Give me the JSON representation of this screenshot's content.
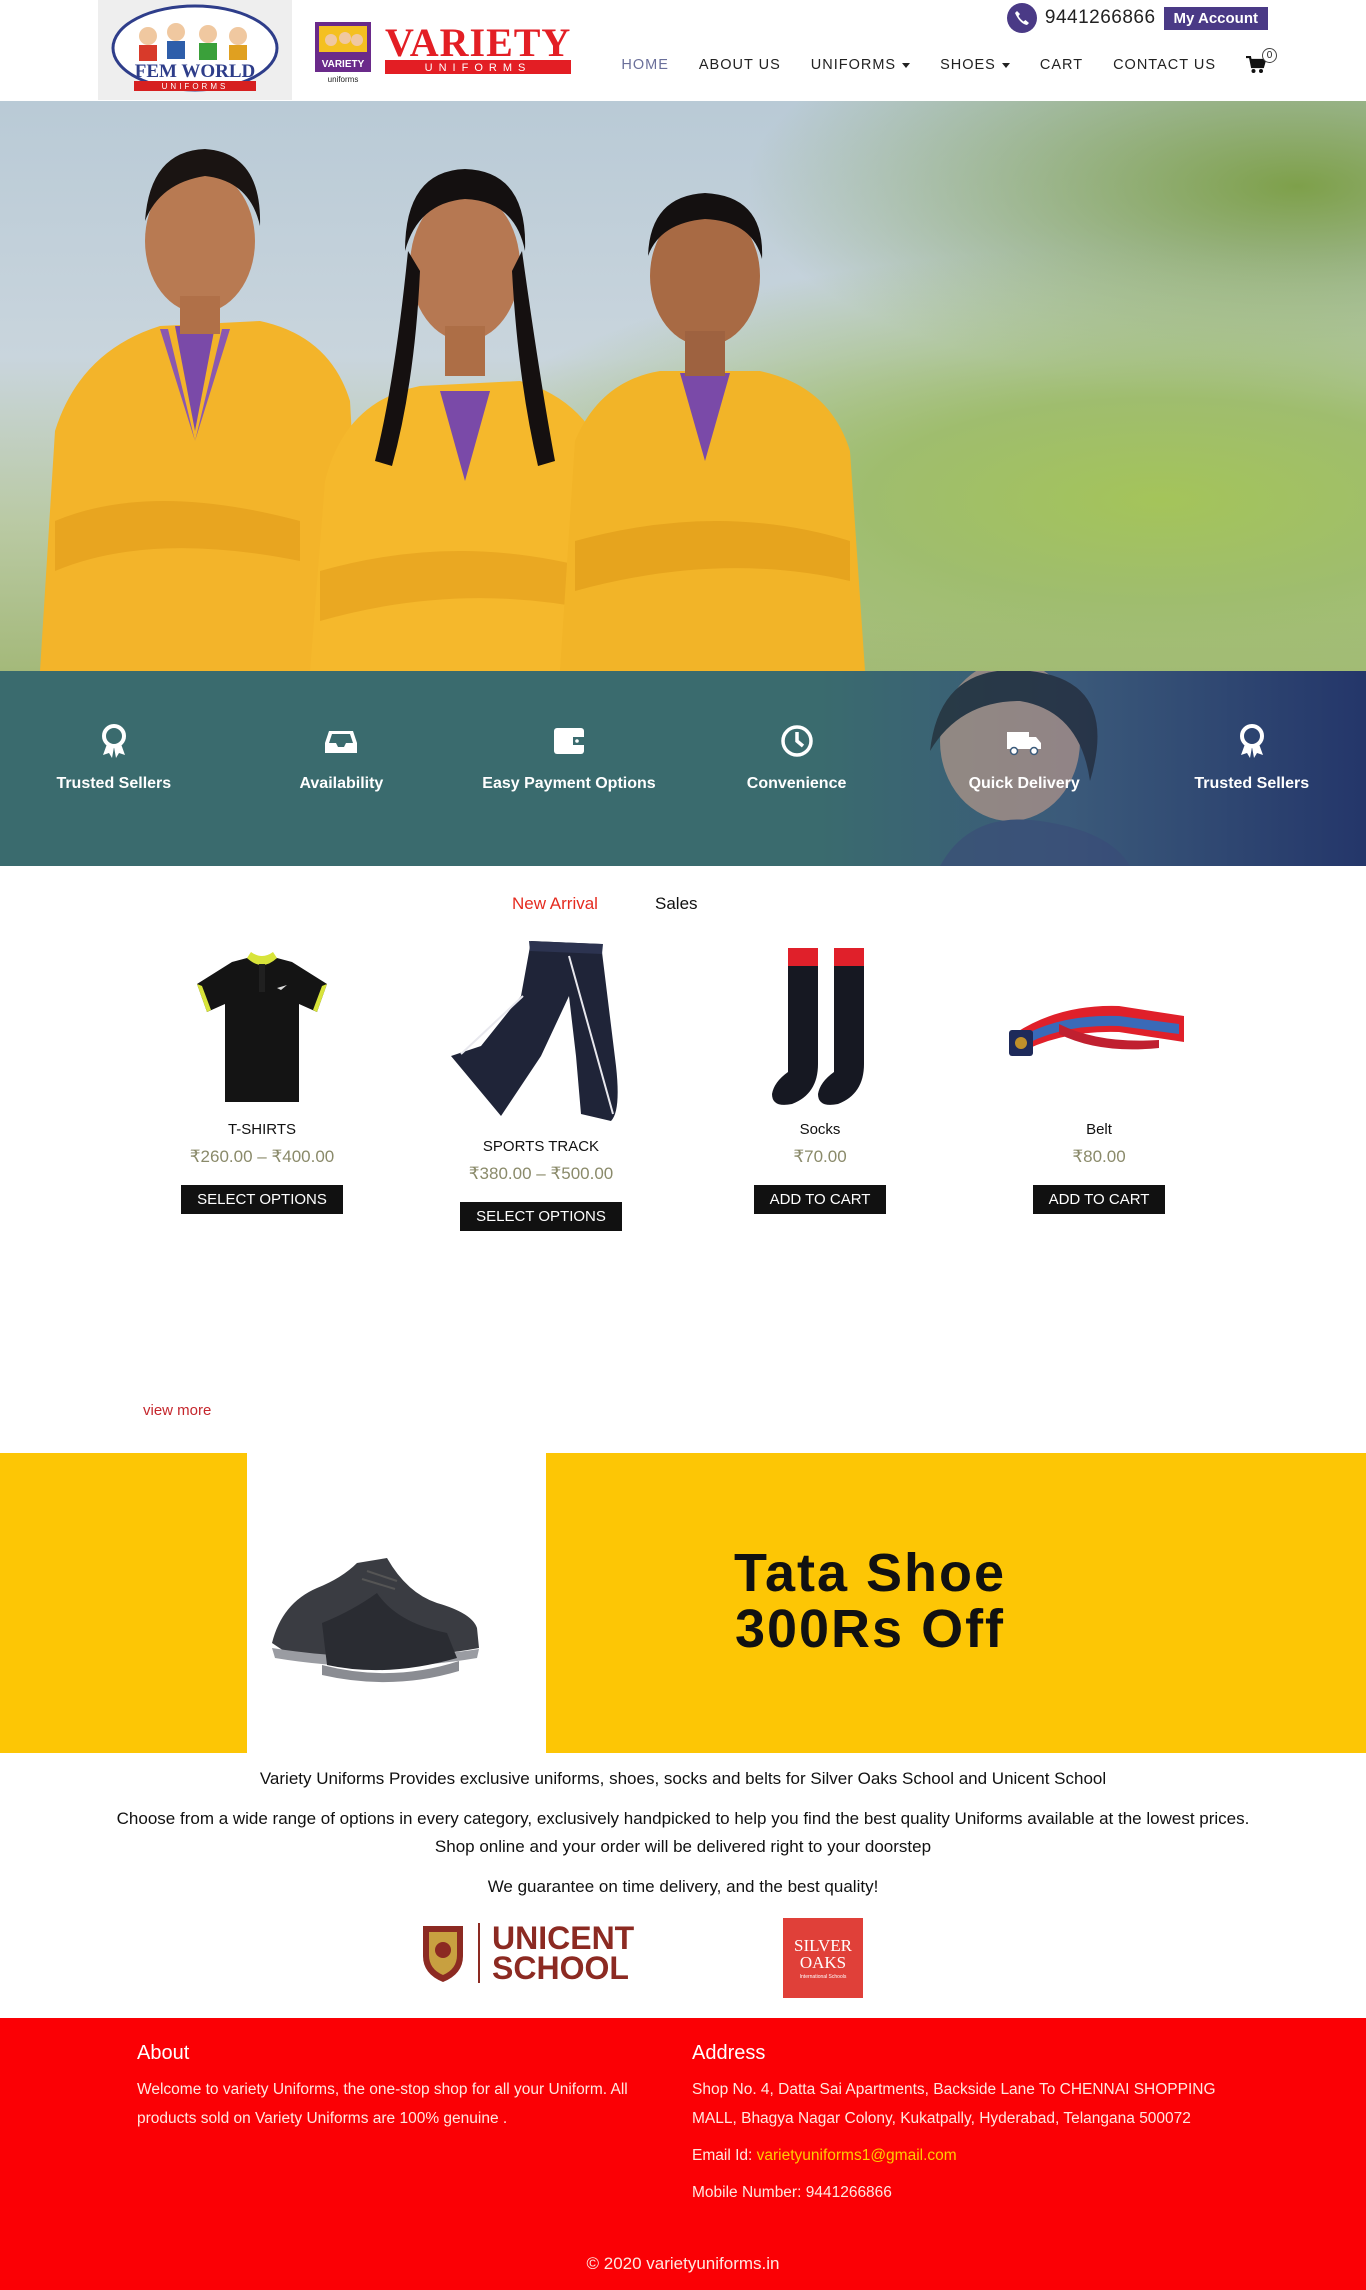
{
  "header": {
    "fem_world_logo": {
      "line1": "FEM WORLD",
      "line2": "UNIFORMS"
    },
    "variety_logo": {
      "title": "VARIETY",
      "subtitle": "UNIFORMS",
      "badge": "VARIETY",
      "badge_small": "uniforms"
    },
    "phone": "9441266866",
    "my_account_label": "My Account",
    "nav": [
      {
        "label": "HOME",
        "active": true
      },
      {
        "label": "ABOUT US"
      },
      {
        "label": "UNIFORMS",
        "dropdown": true
      },
      {
        "label": "SHOES",
        "dropdown": true
      },
      {
        "label": "CART"
      },
      {
        "label": "CONTACT US"
      }
    ],
    "cart_count": "0"
  },
  "features": [
    {
      "label": "Trusted Sellers",
      "icon": "award-icon"
    },
    {
      "label": "Availability",
      "icon": "inbox-icon"
    },
    {
      "label": "Easy Payment Options",
      "icon": "wallet-icon"
    },
    {
      "label": "Convenience",
      "icon": "clock-icon"
    },
    {
      "label": "Quick Delivery",
      "icon": "truck-icon"
    },
    {
      "label": "Trusted Sellers",
      "icon": "award-icon"
    }
  ],
  "tabs": {
    "new_arrival": "New Arrival",
    "sales": "Sales"
  },
  "products": [
    {
      "name": "T-SHIRTS",
      "price": "₹260.00 – ₹400.00",
      "button": "SELECT OPTIONS"
    },
    {
      "name": "SPORTS TRACK",
      "price": "₹380.00 – ₹500.00",
      "button": "SELECT OPTIONS"
    },
    {
      "name": "Socks",
      "price": "₹70.00",
      "button": "ADD TO CART"
    },
    {
      "name": "Belt",
      "price": "₹80.00",
      "button": "ADD TO CART"
    }
  ],
  "view_more": "view more",
  "promo": {
    "line1": "Tata Shoe",
    "line2": "300Rs Off"
  },
  "about": {
    "line1": "Variety Uniforms Provides exclusive uniforms, shoes, socks and belts for Silver Oaks School and Unicent School",
    "line2": "Choose from a wide range of options in every category, exclusively handpicked to help you find the best quality Uniforms available at the lowest prices. Shop online and your order will be delivered right to your doorstep",
    "line3": "We guarantee on time delivery, and the best quality!"
  },
  "schools": {
    "unicent_line1": "UNICENT",
    "unicent_line2": "SCHOOL",
    "silver_line1": "SILVER",
    "silver_line2": "OAKS",
    "silver_line3": "International Schools"
  },
  "footer": {
    "about_title": "About",
    "about_text": "Welcome to variety Uniforms, the one-stop shop for all your Uniform. All products sold on Variety Uniforms are 100% genuine .",
    "address_title": "Address",
    "address_text": "Shop No. 4, Datta Sai Apartments, Backside Lane To CHENNAI SHOPPING MALL, Bhagya Nagar Colony,   Kukatpally, Hyderabad, Telangana 500072",
    "email_label": "Email Id: ",
    "email": "varietyuniforms1@gmail.com",
    "mobile_label": "Mobile Number: ",
    "mobile": "9441266866",
    "copyright": "© 2020 varietyuniforms.in"
  }
}
